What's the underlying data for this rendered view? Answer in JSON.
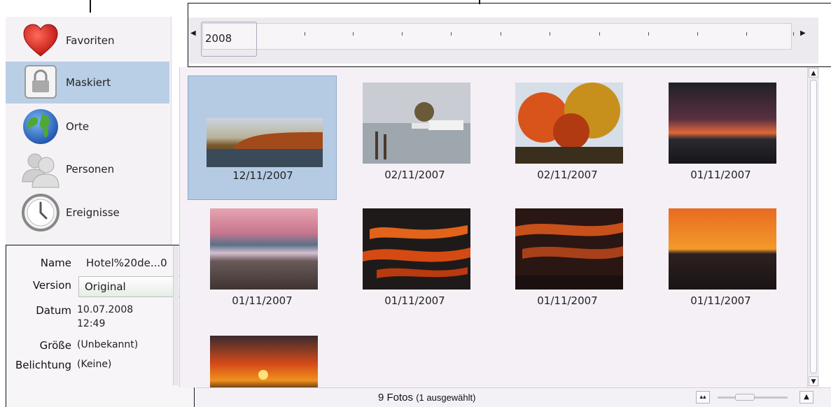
{
  "sidebar": {
    "items": [
      {
        "label": "Favoriten",
        "icon": "heart-icon"
      },
      {
        "label": "Maskiert",
        "icon": "lock-icon",
        "selected": true
      },
      {
        "label": "Orte",
        "icon": "globe-icon"
      },
      {
        "label": "Personen",
        "icon": "people-icon"
      },
      {
        "label": "Ereignisse",
        "icon": "clock-icon"
      }
    ]
  },
  "info": {
    "name_key": "Name",
    "name_val": "Hotel%20de...0",
    "version_key": "Version",
    "version_val": "Original",
    "datum_key": "Datum",
    "datum_val_1": "10.07.2008",
    "datum_val_2": "12:49",
    "groesse_key": "Größe",
    "groesse_val": "(Unbekannt)",
    "belichtung_key": "Belichtung",
    "belichtung_val": "(Keine)"
  },
  "timeline": {
    "year": "2008"
  },
  "photos": [
    {
      "date": "12/11/2007",
      "selected": true
    },
    {
      "date": "02/11/2007"
    },
    {
      "date": "02/11/2007"
    },
    {
      "date": "01/11/2007"
    },
    {
      "date": "01/11/2007"
    },
    {
      "date": "01/11/2007"
    },
    {
      "date": "01/11/2007"
    },
    {
      "date": "01/11/2007"
    },
    {
      "date": ""
    }
  ],
  "status": {
    "count": "9 Fotos",
    "selection": "(1 ausgewählt)"
  },
  "colors": {
    "selection": "#b5cbe3",
    "accent": "#b9cfe6"
  }
}
